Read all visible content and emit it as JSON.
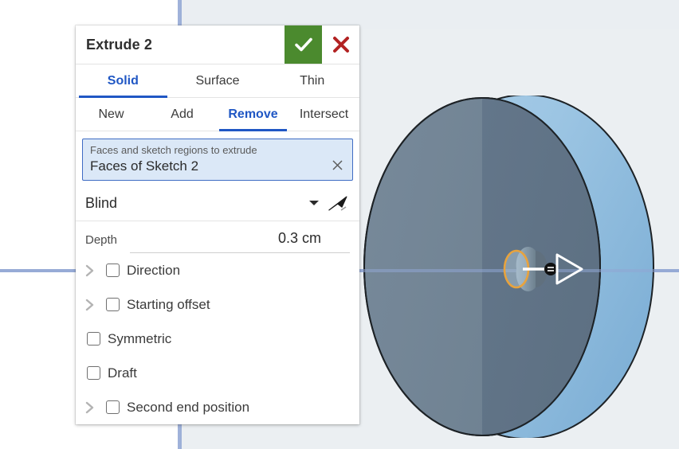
{
  "viewport": {
    "background_color": "#ebeff2",
    "axis_color": "#8fa5d4",
    "model": {
      "name": "extruded-disc",
      "front_face_color": "#6d7f8d",
      "front_face_color_right": "#5f7280",
      "rim_color": "#9cc6e4",
      "rim_color_dark": "#7fb0d6",
      "outline_color": "#1d2226",
      "selected_sketch_color": "#e8a33d",
      "manipulator_color": "#ffffff",
      "manipulator_handle_color": "#111111"
    }
  },
  "dialog": {
    "title": "Extrude 2",
    "accept_label": "✓",
    "cancel_label": "✕",
    "accept_color": "#4b8a2e",
    "cancel_color": "#b22222",
    "accent_color": "#2057c4",
    "tabs_primary": [
      {
        "label": "Solid",
        "active": true
      },
      {
        "label": "Surface",
        "active": false
      },
      {
        "label": "Thin",
        "active": false
      }
    ],
    "tabs_secondary": [
      {
        "label": "New",
        "active": false
      },
      {
        "label": "Add",
        "active": false
      },
      {
        "label": "Remove",
        "active": true
      },
      {
        "label": "Intersect",
        "active": false
      }
    ],
    "selection": {
      "hint": "Faces and sketch regions to extrude",
      "value": "Faces of Sketch 2",
      "clear_label": "✕"
    },
    "end_condition": {
      "value": "Blind",
      "caret_icon": "chevron-down-icon",
      "cursor_icon": "select-arrow-icon"
    },
    "depth": {
      "label": "Depth",
      "value": "0.3 cm"
    },
    "options": [
      {
        "label": "Direction",
        "checked": false,
        "expandable": true
      },
      {
        "label": "Starting offset",
        "checked": false,
        "expandable": true
      },
      {
        "label": "Symmetric",
        "checked": false,
        "expandable": false
      },
      {
        "label": "Draft",
        "checked": false,
        "expandable": false
      },
      {
        "label": "Second end position",
        "checked": false,
        "expandable": true
      }
    ]
  }
}
